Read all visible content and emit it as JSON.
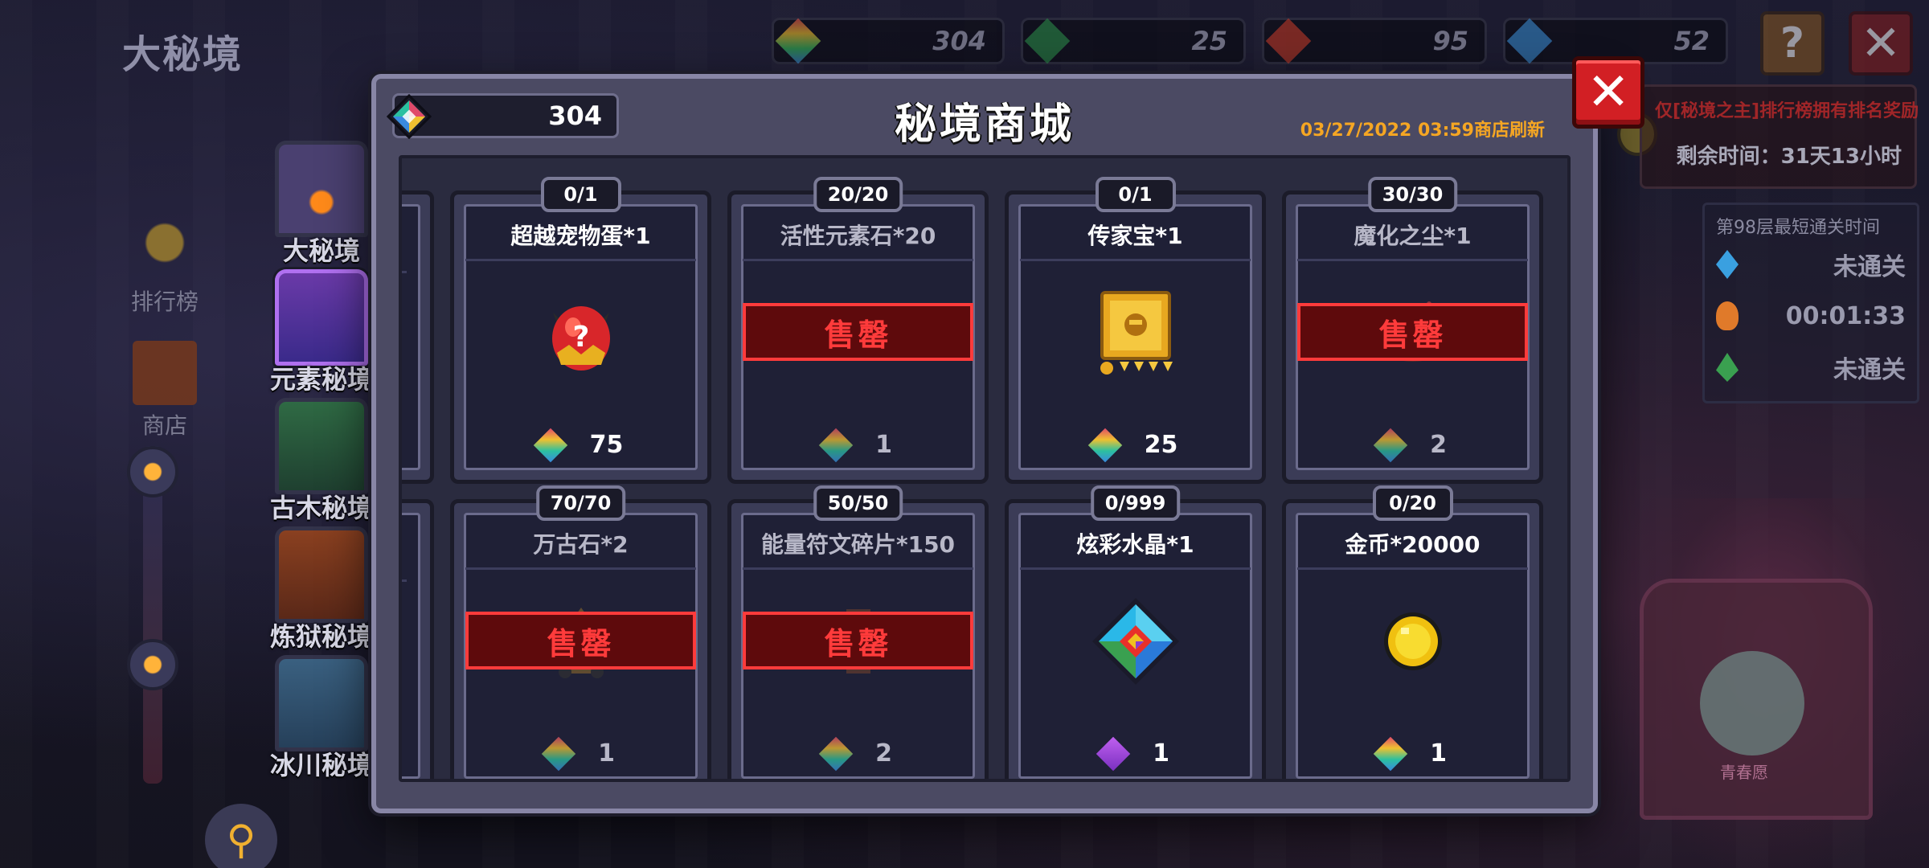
{
  "screen": {
    "title": "大秘境"
  },
  "top_bar": {
    "currencies": [
      {
        "icon": "rainbow-gem-icon",
        "value": "304",
        "color": "#2bc0a0"
      },
      {
        "icon": "green-gem-icon",
        "value": "25",
        "color": "#2b8a4a"
      },
      {
        "icon": "red-gem-icon",
        "value": "95",
        "color": "#c03a2a"
      },
      {
        "icon": "blue-gem-icon",
        "value": "52",
        "color": "#3a8ad0"
      }
    ],
    "help_label": "?",
    "close_label": "✕"
  },
  "left_nav": {
    "small_items": [
      {
        "label": "排行榜",
        "icon": "trophy-icon"
      },
      {
        "label": "商店",
        "icon": "shop-icon"
      }
    ],
    "tabs": [
      {
        "label": "大秘境",
        "icon": "purple-portal-icon",
        "color": "#6e5aa8"
      },
      {
        "label": "元素秘境",
        "icon": "element-portal-icon",
        "color": "#9a4ad8",
        "active": true
      },
      {
        "label": "古木秘境",
        "icon": "wood-portal-icon",
        "color": "#3e9a5a"
      },
      {
        "label": "炼狱秘境",
        "icon": "hell-portal-icon",
        "color": "#c8652a"
      },
      {
        "label": "冰川秘境",
        "icon": "ice-portal-icon",
        "color": "#4a7ea0"
      }
    ]
  },
  "right_panel": {
    "reward_warning": "仅[秘境之主]排行榜拥有排名奖励",
    "remaining_time": "剩余时间：31天13小时",
    "clear_time": {
      "header": "第98层最短通关时间",
      "rows": [
        {
          "icon": "water-element-icon",
          "value": "未通关",
          "color": "#3aa0e0"
        },
        {
          "icon": "fire-element-icon",
          "value": "00:01:33",
          "color": "#e07a2a"
        },
        {
          "icon": "wood-element-icon",
          "value": "未通关",
          "color": "#3aa050"
        }
      ]
    },
    "boss_name": "青春愿"
  },
  "shop": {
    "title": "秘境商城",
    "balance": "304",
    "refresh_text": "03/27/2022 03:59商店刷新",
    "close_label": "✕",
    "sold_out_label": "售罄",
    "items": [
      {
        "stock": "0/1",
        "name": "超越宠物蛋*1",
        "price": "75",
        "sold_out": false,
        "art": "pet-egg-icon",
        "currency": "rainbow-gem-icon"
      },
      {
        "stock": "20/20",
        "name": "活性元素石*20",
        "price": "1",
        "sold_out": true,
        "art": "element-stone-icon",
        "currency": "rainbow-gem-icon"
      },
      {
        "stock": "0/1",
        "name": "传家宝*1",
        "price": "25",
        "sold_out": false,
        "art": "heirloom-icon",
        "currency": "rainbow-gem-icon"
      },
      {
        "stock": "30/30",
        "name": "魔化之尘*1",
        "price": "2",
        "sold_out": true,
        "art": "magic-dust-icon",
        "currency": "rainbow-gem-icon"
      },
      {
        "stock": "70/70",
        "name": "万古石*2",
        "price": "1",
        "sold_out": true,
        "art": "ancient-stone-icon",
        "currency": "rainbow-gem-icon"
      },
      {
        "stock": "50/50",
        "name": "能量符文碎片*150",
        "price": "2",
        "sold_out": true,
        "art": "rune-fragment-icon",
        "currency": "rainbow-gem-icon"
      },
      {
        "stock": "0/999",
        "name": "炫彩水晶*1",
        "price": "1",
        "sold_out": false,
        "art": "prism-crystal-icon",
        "currency": "purple-gem-icon"
      },
      {
        "stock": "0/20",
        "name": "金币*20000",
        "price": "1",
        "sold_out": false,
        "art": "gold-coin-icon",
        "currency": "rainbow-gem-icon"
      }
    ]
  }
}
